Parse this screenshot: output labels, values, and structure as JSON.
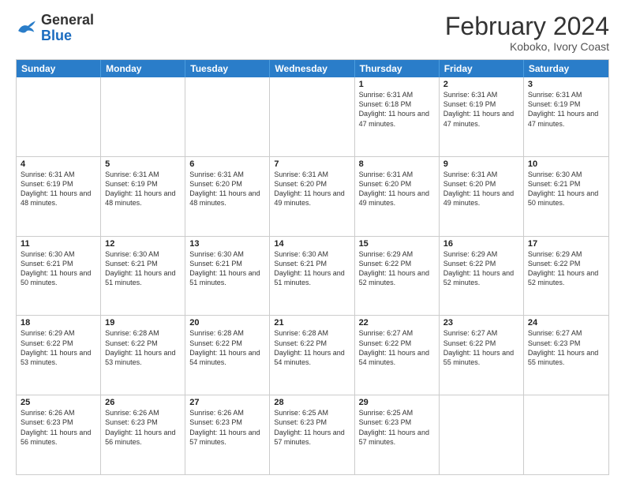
{
  "logo": {
    "general": "General",
    "blue": "Blue"
  },
  "header": {
    "month_year": "February 2024",
    "location": "Koboko, Ivory Coast"
  },
  "days_of_week": [
    "Sunday",
    "Monday",
    "Tuesday",
    "Wednesday",
    "Thursday",
    "Friday",
    "Saturday"
  ],
  "rows": [
    [
      {
        "empty": true
      },
      {
        "empty": true
      },
      {
        "empty": true
      },
      {
        "empty": true
      },
      {
        "day": "1",
        "sunrise": "6:31 AM",
        "sunset": "6:18 PM",
        "daylight": "11 hours and 47 minutes."
      },
      {
        "day": "2",
        "sunrise": "6:31 AM",
        "sunset": "6:19 PM",
        "daylight": "11 hours and 47 minutes."
      },
      {
        "day": "3",
        "sunrise": "6:31 AM",
        "sunset": "6:19 PM",
        "daylight": "11 hours and 47 minutes."
      }
    ],
    [
      {
        "day": "4",
        "sunrise": "6:31 AM",
        "sunset": "6:19 PM",
        "daylight": "11 hours and 48 minutes."
      },
      {
        "day": "5",
        "sunrise": "6:31 AM",
        "sunset": "6:19 PM",
        "daylight": "11 hours and 48 minutes."
      },
      {
        "day": "6",
        "sunrise": "6:31 AM",
        "sunset": "6:20 PM",
        "daylight": "11 hours and 48 minutes."
      },
      {
        "day": "7",
        "sunrise": "6:31 AM",
        "sunset": "6:20 PM",
        "daylight": "11 hours and 49 minutes."
      },
      {
        "day": "8",
        "sunrise": "6:31 AM",
        "sunset": "6:20 PM",
        "daylight": "11 hours and 49 minutes."
      },
      {
        "day": "9",
        "sunrise": "6:31 AM",
        "sunset": "6:20 PM",
        "daylight": "11 hours and 49 minutes."
      },
      {
        "day": "10",
        "sunrise": "6:30 AM",
        "sunset": "6:21 PM",
        "daylight": "11 hours and 50 minutes."
      }
    ],
    [
      {
        "day": "11",
        "sunrise": "6:30 AM",
        "sunset": "6:21 PM",
        "daylight": "11 hours and 50 minutes."
      },
      {
        "day": "12",
        "sunrise": "6:30 AM",
        "sunset": "6:21 PM",
        "daylight": "11 hours and 51 minutes."
      },
      {
        "day": "13",
        "sunrise": "6:30 AM",
        "sunset": "6:21 PM",
        "daylight": "11 hours and 51 minutes."
      },
      {
        "day": "14",
        "sunrise": "6:30 AM",
        "sunset": "6:21 PM",
        "daylight": "11 hours and 51 minutes."
      },
      {
        "day": "15",
        "sunrise": "6:29 AM",
        "sunset": "6:22 PM",
        "daylight": "11 hours and 52 minutes."
      },
      {
        "day": "16",
        "sunrise": "6:29 AM",
        "sunset": "6:22 PM",
        "daylight": "11 hours and 52 minutes."
      },
      {
        "day": "17",
        "sunrise": "6:29 AM",
        "sunset": "6:22 PM",
        "daylight": "11 hours and 52 minutes."
      }
    ],
    [
      {
        "day": "18",
        "sunrise": "6:29 AM",
        "sunset": "6:22 PM",
        "daylight": "11 hours and 53 minutes."
      },
      {
        "day": "19",
        "sunrise": "6:28 AM",
        "sunset": "6:22 PM",
        "daylight": "11 hours and 53 minutes."
      },
      {
        "day": "20",
        "sunrise": "6:28 AM",
        "sunset": "6:22 PM",
        "daylight": "11 hours and 54 minutes."
      },
      {
        "day": "21",
        "sunrise": "6:28 AM",
        "sunset": "6:22 PM",
        "daylight": "11 hours and 54 minutes."
      },
      {
        "day": "22",
        "sunrise": "6:27 AM",
        "sunset": "6:22 PM",
        "daylight": "11 hours and 54 minutes."
      },
      {
        "day": "23",
        "sunrise": "6:27 AM",
        "sunset": "6:22 PM",
        "daylight": "11 hours and 55 minutes."
      },
      {
        "day": "24",
        "sunrise": "6:27 AM",
        "sunset": "6:23 PM",
        "daylight": "11 hours and 55 minutes."
      }
    ],
    [
      {
        "day": "25",
        "sunrise": "6:26 AM",
        "sunset": "6:23 PM",
        "daylight": "11 hours and 56 minutes."
      },
      {
        "day": "26",
        "sunrise": "6:26 AM",
        "sunset": "6:23 PM",
        "daylight": "11 hours and 56 minutes."
      },
      {
        "day": "27",
        "sunrise": "6:26 AM",
        "sunset": "6:23 PM",
        "daylight": "11 hours and 57 minutes."
      },
      {
        "day": "28",
        "sunrise": "6:25 AM",
        "sunset": "6:23 PM",
        "daylight": "11 hours and 57 minutes."
      },
      {
        "day": "29",
        "sunrise": "6:25 AM",
        "sunset": "6:23 PM",
        "daylight": "11 hours and 57 minutes."
      },
      {
        "empty": true
      },
      {
        "empty": true
      }
    ]
  ]
}
